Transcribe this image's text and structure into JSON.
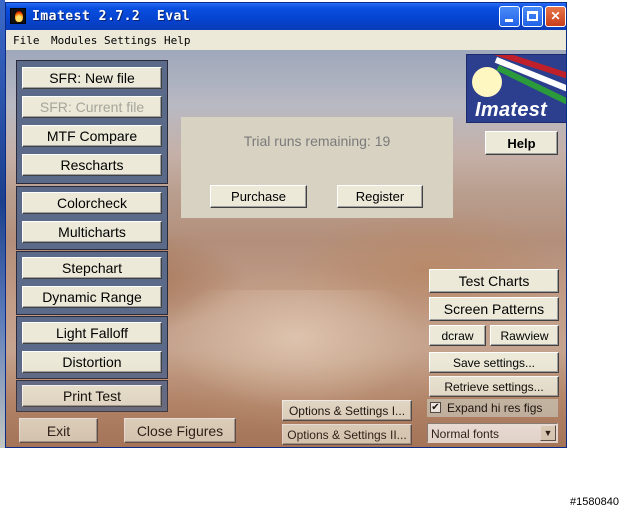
{
  "window": {
    "title": "Imatest 2.7.2  Eval",
    "minimize_label": "",
    "maximize_label": "",
    "close_label": "✕"
  },
  "menu": [
    "File",
    "Modules",
    "Settings",
    "Help"
  ],
  "left_panels": [
    [
      "SFR: New file",
      "SFR: Current file",
      "MTF Compare",
      "Rescharts"
    ],
    [
      "Colorcheck",
      "Multicharts"
    ],
    [
      "Stepchart",
      "Dynamic Range"
    ],
    [
      "Light Falloff",
      "Distortion"
    ],
    [
      "Print Test"
    ]
  ],
  "disabled_buttons": [
    "SFR: Current file"
  ],
  "logo_text": "Imatest",
  "help_label": "Help",
  "trial": {
    "message": "Trial runs remaining: 19",
    "purchase_label": "Purchase",
    "register_label": "Register"
  },
  "right_buttons": {
    "test_charts": "Test Charts",
    "screen_patterns": "Screen Patterns",
    "dcraw": "dcraw",
    "rawview": "Rawview",
    "save_settings": "Save settings...",
    "retrieve_settings": "Retrieve settings...",
    "expand_hi_res": "Expand hi res figs",
    "expand_checked": true,
    "fonts_selected": "Normal fonts"
  },
  "bottom_buttons": {
    "exit": "Exit",
    "close_figures": "Close Figures",
    "options_1": "Options & Settings I...",
    "options_2": "Options & Settings II..."
  },
  "watermark": "#1580840",
  "colors": {
    "titlebar": "#0543d0",
    "panel": "#5c6a8a",
    "button_face": "#ece9d8",
    "logo_bg": "#2b3f8e"
  }
}
